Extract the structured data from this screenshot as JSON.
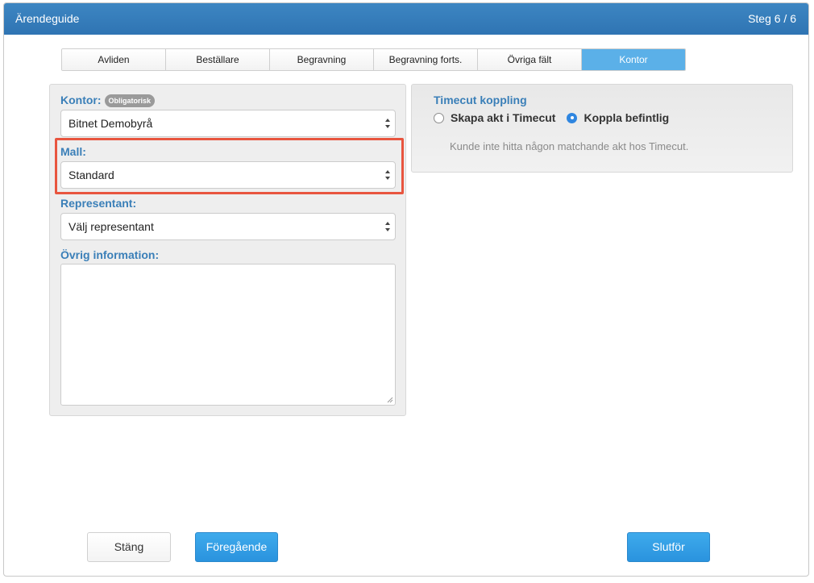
{
  "header": {
    "title": "Ärendeguide",
    "step": "Steg 6 / 6"
  },
  "tabs": [
    {
      "label": "Avliden"
    },
    {
      "label": "Beställare"
    },
    {
      "label": "Begravning"
    },
    {
      "label": "Begravning forts."
    },
    {
      "label": "Övriga fält"
    },
    {
      "label": "Kontor"
    }
  ],
  "form": {
    "kontor_label": "Kontor:",
    "kontor_badge": "Obligatorisk",
    "kontor_value": "Bitnet Demobyrå",
    "mall_label": "Mall:",
    "mall_value": "Standard",
    "representant_label": "Representant:",
    "representant_value": "Välj representant",
    "ovrig_label": "Övrig information:",
    "ovrig_value": ""
  },
  "timecut": {
    "title": "Timecut koppling",
    "option_create": "Skapa akt i Timecut",
    "option_link": "Koppla befintlig",
    "selected": "Koppla befintlig",
    "note": "Kunde inte hitta någon matchande akt hos Timecut."
  },
  "buttons": {
    "close": "Stäng",
    "previous": "Föregående",
    "finish": "Slutför"
  },
  "colors": {
    "header": "#2f74b3",
    "accent": "#2a93de",
    "highlight": "#e8553f",
    "label": "#3a7fb8"
  }
}
